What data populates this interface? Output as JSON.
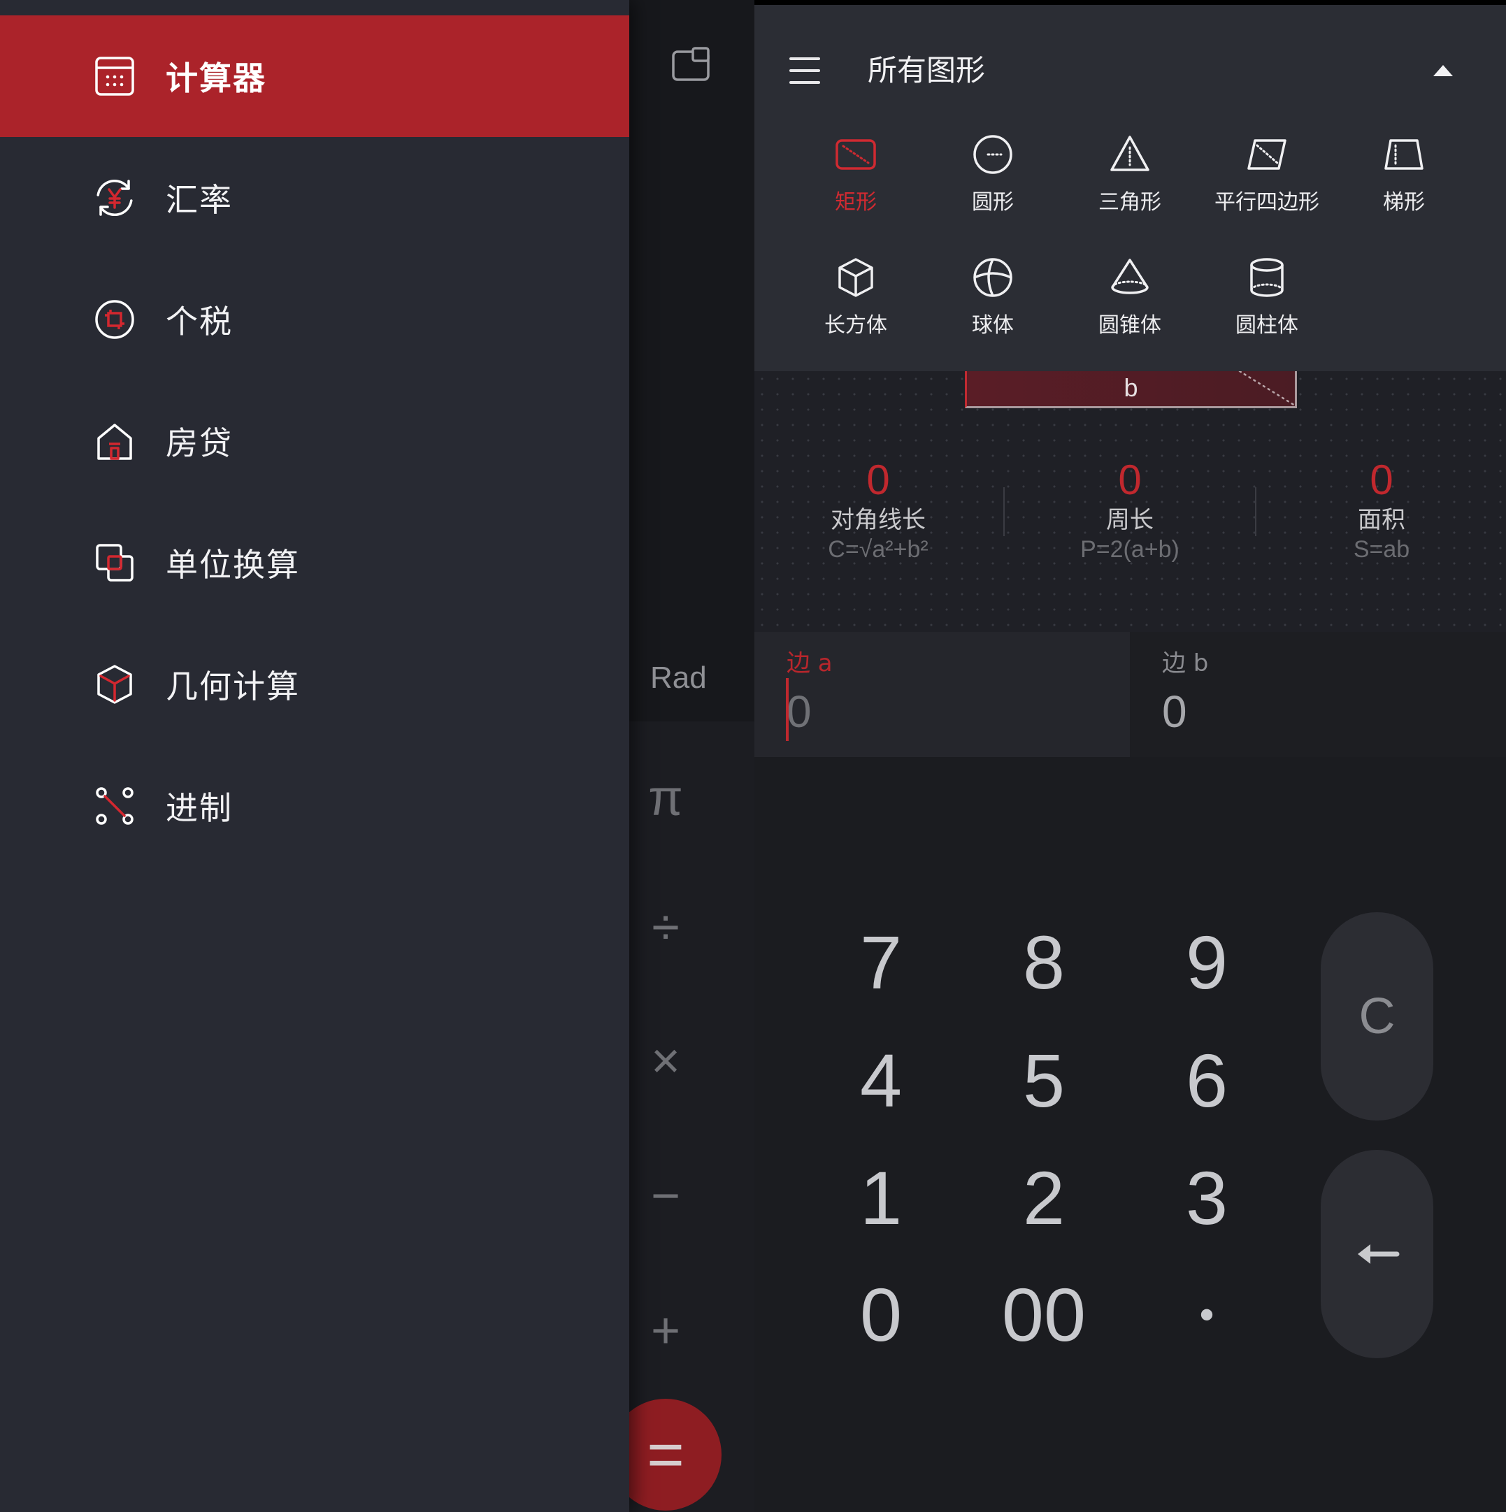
{
  "drawer": {
    "items": [
      {
        "label": "计算器",
        "icon": "calculator-icon",
        "selected": true
      },
      {
        "label": "汇率",
        "icon": "exchange-rate-icon",
        "selected": false
      },
      {
        "label": "个税",
        "icon": "income-tax-icon",
        "selected": false
      },
      {
        "label": "房贷",
        "icon": "house-icon",
        "selected": false
      },
      {
        "label": "单位换算",
        "icon": "unit-conversion-icon",
        "selected": false
      },
      {
        "label": "几何计算",
        "icon": "cube-icon",
        "selected": false
      },
      {
        "label": "进制",
        "icon": "number-base-icon",
        "selected": false
      }
    ]
  },
  "calculator": {
    "window_icon": "picture-in-picture-icon",
    "angle_mode": "Rad",
    "operators": [
      "π",
      "÷",
      "×",
      "−",
      "+"
    ],
    "equals": "="
  },
  "geometry": {
    "menu_icon": "hamburger-icon",
    "title": "所有图形",
    "collapse_icon": "caret-up-icon",
    "shapes": [
      {
        "label": "矩形",
        "icon": "rectangle-icon",
        "selected": true
      },
      {
        "label": "圆形",
        "icon": "circle-icon",
        "selected": false
      },
      {
        "label": "三角形",
        "icon": "triangle-icon",
        "selected": false
      },
      {
        "label": "平行四边形",
        "icon": "parallelogram-icon",
        "selected": false
      },
      {
        "label": "梯形",
        "icon": "trapezoid-icon",
        "selected": false
      },
      {
        "label": "长方体",
        "icon": "cuboid-icon",
        "selected": false
      },
      {
        "label": "球体",
        "icon": "sphere-icon",
        "selected": false
      },
      {
        "label": "圆锥体",
        "icon": "cone-icon",
        "selected": false
      },
      {
        "label": "圆柱体",
        "icon": "cylinder-icon",
        "selected": false
      }
    ],
    "diagram_side_label": "b",
    "results": [
      {
        "value": "0",
        "label": "对角线长",
        "formula": "C=√a²+b²"
      },
      {
        "value": "0",
        "label": "周长",
        "formula": "P=2(a+b)"
      },
      {
        "value": "0",
        "label": "面积",
        "formula": "S=ab"
      }
    ],
    "inputs": [
      {
        "label": "边 a",
        "value": "0",
        "active": true
      },
      {
        "label": "边 b",
        "value": "0",
        "active": false
      }
    ]
  },
  "keypad": {
    "keys": [
      "7",
      "8",
      "9",
      "4",
      "5",
      "6",
      "1",
      "2",
      "3",
      "0",
      "00",
      "•"
    ],
    "clear": "C",
    "backspace_icon": "backspace-arrow-icon"
  },
  "colors": {
    "accent": "#ab232a",
    "accent_text": "#c1282e",
    "drawer_bg": "#282a33",
    "header_bg": "#2b2d34",
    "keypad_bg": "#1b1c20",
    "key_text": "#c8c9cd"
  }
}
